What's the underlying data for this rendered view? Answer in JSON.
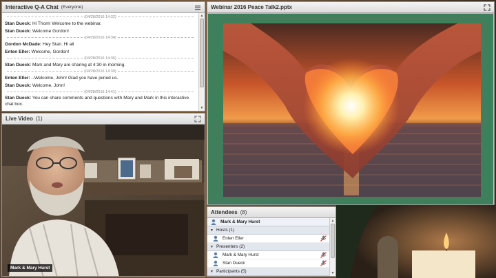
{
  "chat": {
    "title": "Interactive Q-A Chat",
    "audience": "(Everyone)",
    "entries": [
      {
        "type": "msg",
        "sender": "Stan Dueck:",
        "text": " Hi Thom! Welcome to the webinar."
      },
      {
        "type": "msg",
        "sender": "Stan Dueck:",
        "text": " Welcome Gordon!"
      },
      {
        "type": "ts",
        "text": "(04/28/2016 14:34)"
      },
      {
        "type": "msg",
        "sender": "Gordon McDade:",
        "text": " Hey Stan. Hi all"
      },
      {
        "type": "msg",
        "sender": "Enten Eller:",
        "text": " Welcome, Gordon!"
      },
      {
        "type": "ts",
        "text": "(04/28/2016 14:36)"
      },
      {
        "type": "msg",
        "sender": "Stan Dueck:",
        "text": " Mark and Mary are sharing at 4:30 in morning."
      },
      {
        "type": "ts",
        "text": "(04/28/2016 14:39)"
      },
      {
        "type": "msg",
        "sender": "Enten Eller:",
        "text": " --Welcome, John!  Glad you have joined us."
      },
      {
        "type": "msg",
        "sender": "Stan Dueck:",
        "text": " Welcome, John!"
      },
      {
        "type": "ts",
        "text": "(04/28/2016 14:41)"
      },
      {
        "type": "msg",
        "sender": "Stan Dueck:",
        "text": " You can share comments and questions with Mary and Mark in this interactive chat box."
      }
    ],
    "top_timestamp": "(04/28/2016 14:32)"
  },
  "video": {
    "title": "Live Video",
    "count": "(1)",
    "nametag": "Mark & Mary Hurst"
  },
  "share": {
    "title": "Webinar 2016 Peace Talk2.pptx"
  },
  "attendees": {
    "title": "Attendees",
    "count": "(8)",
    "self": "Mark & Mary Hurst",
    "groups": [
      {
        "label": "Hosts (1)",
        "members": [
          "Enten Eller"
        ]
      },
      {
        "label": "Presenters (2)",
        "members": [
          "Mark & Mary Hurst",
          "Stan Dueck"
        ]
      },
      {
        "label": "Participants (5)",
        "members": []
      }
    ]
  },
  "colors": {
    "slide_border": "#3f7f5c",
    "pod_header": "#dcdcdc"
  }
}
